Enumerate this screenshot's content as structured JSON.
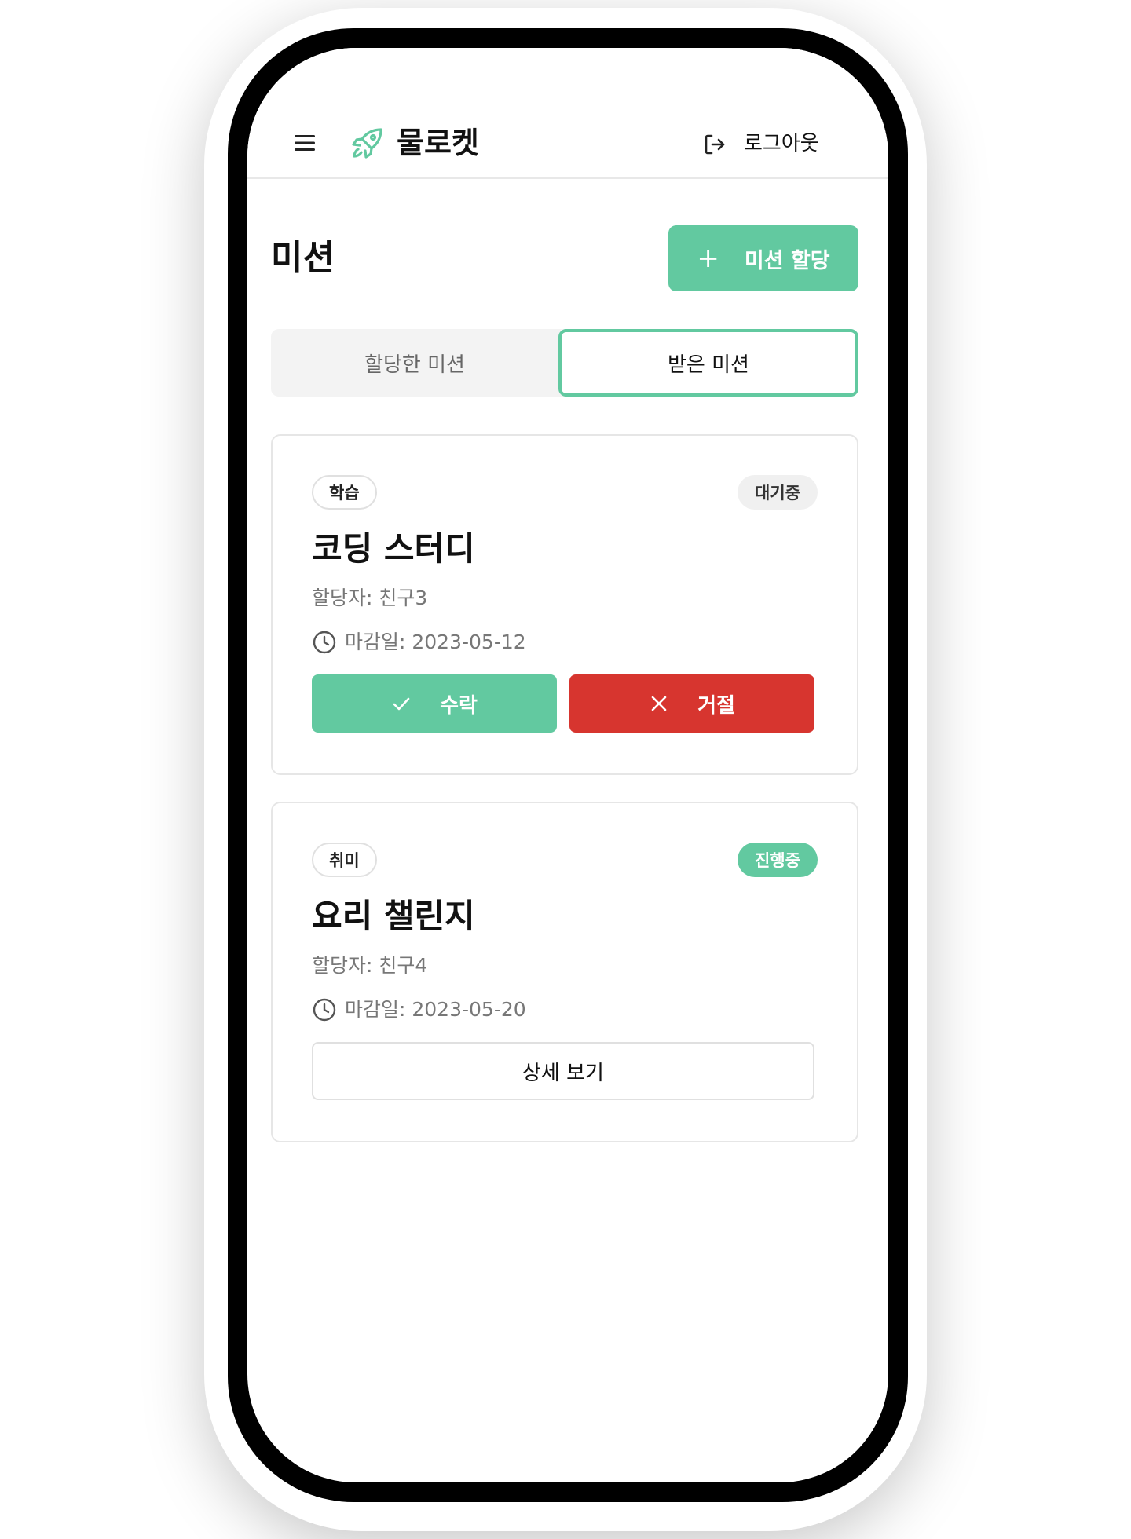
{
  "header": {
    "app_title": "물로켓",
    "logout_label": "로그아웃"
  },
  "page": {
    "title": "미션",
    "assign_button_label": "미션 할당"
  },
  "tabs": [
    {
      "label": "할당한 미션",
      "active": false
    },
    {
      "label": "받은 미션",
      "active": true
    }
  ],
  "missions": [
    {
      "category": "학습",
      "status": "대기중",
      "title": "코딩 스터디",
      "assignee": "할당자: 친구3",
      "deadline": "마감일: 2023-05-12",
      "accept_label": "수락",
      "reject_label": "거절"
    },
    {
      "category": "취미",
      "status": "진행중",
      "title": "요리 챌린지",
      "assignee": "할당자: 친구4",
      "deadline": "마감일: 2023-05-20",
      "detail_label": "상세 보기"
    }
  ],
  "colors": {
    "accent": "#62c9a0",
    "danger": "#d7352f"
  }
}
